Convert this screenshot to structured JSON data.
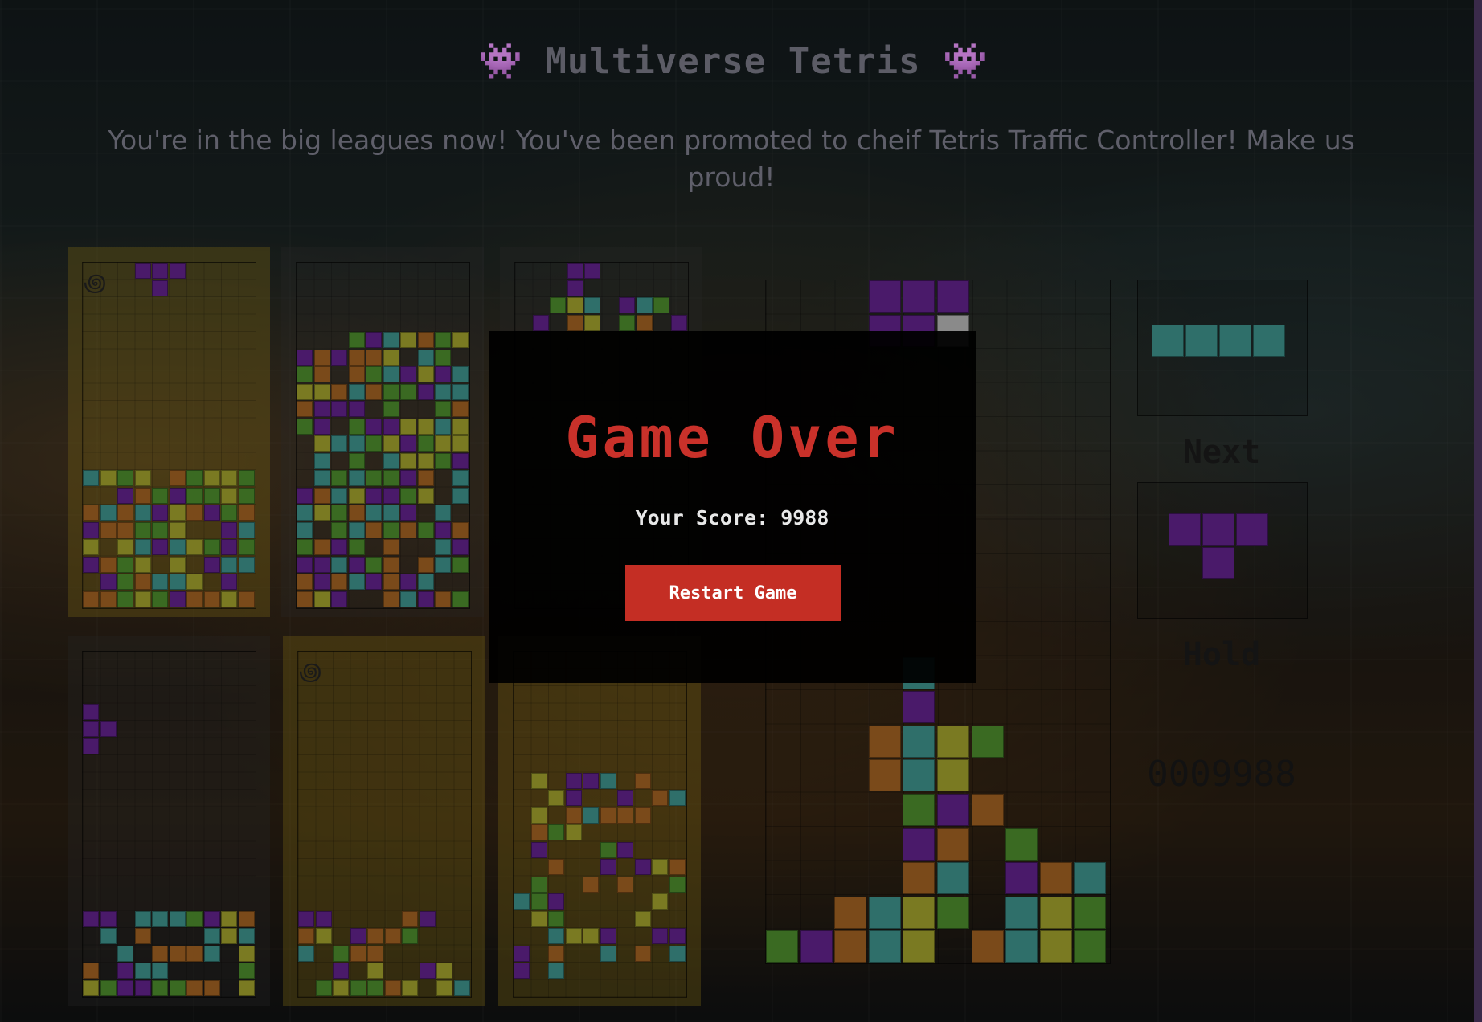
{
  "header": {
    "title": "👾 Multiverse Tetris 👾",
    "subtitle": "You're in the big leagues now! You've been promoted to cheif Tetris Traffic Controller! Make us proud!"
  },
  "game_over": {
    "title": "Game Over",
    "score_text": "Your Score: 9988",
    "restart_label": "Restart Game"
  },
  "side": {
    "next_label": "Next",
    "hold_label": "Hold",
    "score_display": "0009988"
  },
  "colors": {
    "purple": "#4a1a6a",
    "green": "#3a6a22",
    "yellow": "#7a7a22",
    "teal": "#2f6f6a",
    "orange": "#7a4a1a",
    "grey": "#8a8a8a",
    "accent_red": "#c42e24"
  }
}
